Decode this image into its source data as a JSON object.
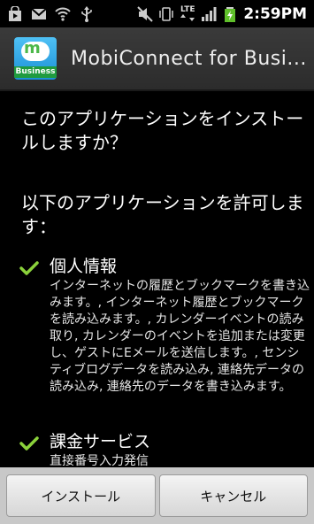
{
  "status_bar": {
    "time": "2:59PM",
    "network_label": "LTE",
    "left_icons": [
      "shopping-bag-icon",
      "gmail-icon",
      "wifi-icon",
      "usb-icon"
    ],
    "right_icons": [
      "mute-icon",
      "vibrate-icon",
      "lte-icon",
      "signal-icon",
      "battery-charging-icon"
    ]
  },
  "title_bar": {
    "app_icon_label": "Business",
    "app_icon_letter": "m",
    "title": "MobiConnect for Busi..."
  },
  "content": {
    "question": "このアプリケーションをインストールしますか？",
    "permissions_header": "以下のアプリケーションを許可します：",
    "permissions": [
      {
        "title": "個人情報",
        "description": "インターネットの履歴とブックマークを書き込みます。, インターネット履歴とブックマークを読み込みます。, カレンダーイベントの読み取り, カレンダーのイベントを追加または変更し、ゲストにEメールを送信します。, センシティブログデータを読み込み, 連絡先データの読み込み, 連絡先のデータを書き込みます。"
      },
      {
        "title": "課金サービス",
        "description": "直接番号入力発信"
      }
    ]
  },
  "buttons": {
    "install": "インストール",
    "cancel": "キャンセル"
  },
  "colors": {
    "check": "#8bd23b",
    "background": "#000000",
    "button_bar": "#c8c8c8"
  }
}
